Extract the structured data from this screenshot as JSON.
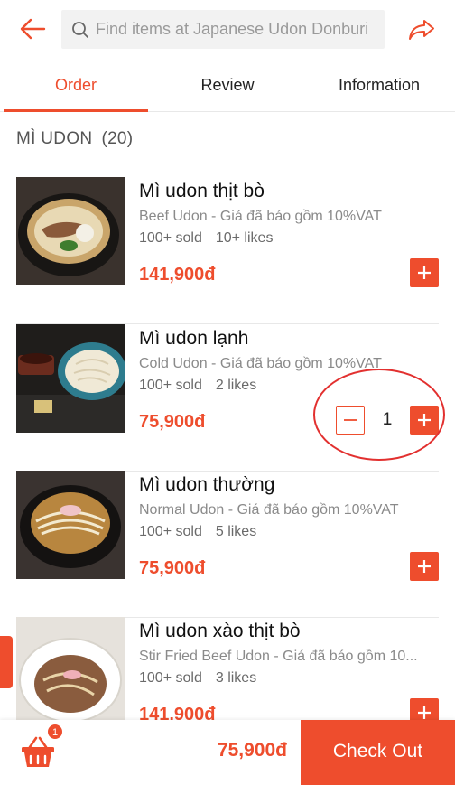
{
  "colors": {
    "accent": "#ee4d2d",
    "annotation": "#e2302f"
  },
  "header": {
    "back_icon": "arrow-left-icon",
    "search_icon": "search-icon",
    "search_placeholder": "Find items at Japanese Udon Donburi",
    "share_icon": "share-arrow-icon"
  },
  "tabs": [
    {
      "label": "Order",
      "active": true
    },
    {
      "label": "Review",
      "active": false
    },
    {
      "label": "Information",
      "active": false
    }
  ],
  "section": {
    "title": "MÌ UDON",
    "count": "(20)"
  },
  "items": [
    {
      "name": "Mì udon thịt bò",
      "desc": "Beef Udon - Giá đã báo gồm 10%VAT",
      "sold": "100+ sold",
      "likes": "10+ likes",
      "price": "141,900đ"
    },
    {
      "name": "Mì udon lạnh",
      "desc": "Cold Udon - Giá đã báo gồm 10%VAT",
      "sold": "100+ sold",
      "likes": "2 likes",
      "price": "75,900đ",
      "quantity": "1"
    },
    {
      "name": "Mì udon thường",
      "desc": "Normal Udon - Giá đã báo gồm 10%VAT",
      "sold": "100+ sold",
      "likes": "5 likes",
      "price": "75,900đ"
    },
    {
      "name": "Mì udon xào thịt bò",
      "desc": "Stir Fried Beef Udon - Giá đã báo gồm 10...",
      "sold": "100+ sold",
      "likes": "3 likes",
      "price": "141,900đ"
    }
  ],
  "cart": {
    "icon": "basket-icon",
    "badge": "1",
    "total": "75,900đ",
    "checkout_label": "Check Out"
  }
}
